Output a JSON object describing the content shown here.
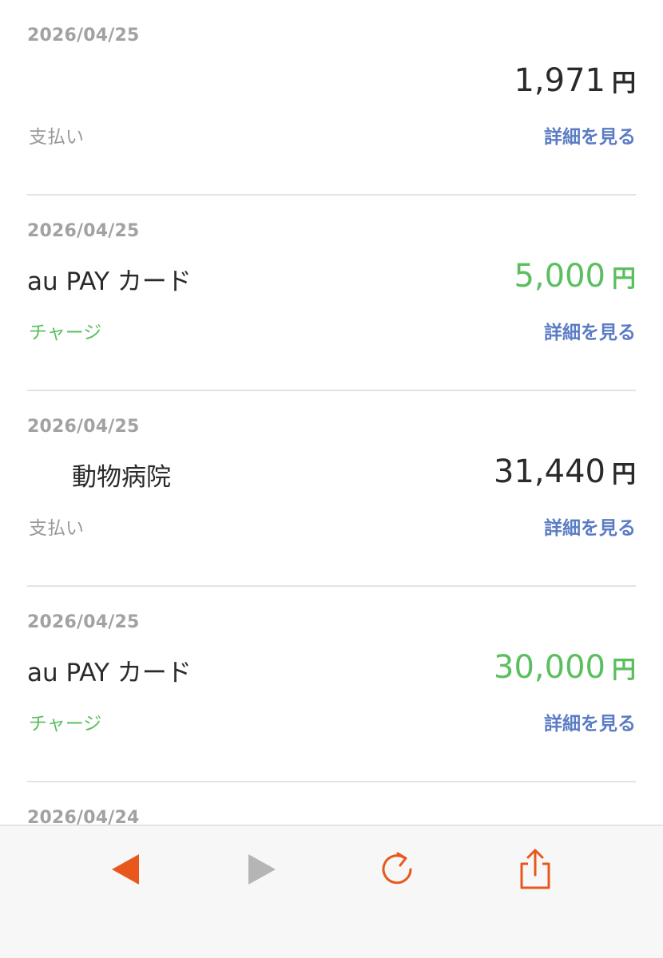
{
  "transactions": [
    {
      "date": "2026/04/25",
      "merchant": "",
      "amount": "1,971",
      "unit": "円",
      "type": "支払い",
      "detail_label": "詳細を見る"
    },
    {
      "date": "2026/04/25",
      "merchant": "au PAY カード",
      "amount": "5,000",
      "unit": "円",
      "type": "チャージ",
      "detail_label": "詳細を見る"
    },
    {
      "date": "2026/04/25",
      "merchant": "動物病院",
      "amount": "31,440",
      "unit": "円",
      "type": "支払い",
      "detail_label": "詳細を見る"
    },
    {
      "date": "2026/04/25",
      "merchant": "au PAY カード",
      "amount": "30,000",
      "unit": "円",
      "type": "チャージ",
      "detail_label": "詳細を見る"
    },
    {
      "date": "2026/04/24"
    }
  ],
  "colors": {
    "charge": "#5bbf5f",
    "link": "#5b7cc4",
    "muted": "#a2a2a2",
    "accent": "#e8581c",
    "disabled": "#b5b5b5"
  },
  "toolbar": {
    "back": {
      "icon": "back-arrow-icon",
      "enabled": true
    },
    "forward": {
      "icon": "forward-arrow-icon",
      "enabled": false
    },
    "reload": {
      "icon": "reload-icon",
      "enabled": true
    },
    "share": {
      "icon": "share-icon",
      "enabled": true
    }
  }
}
